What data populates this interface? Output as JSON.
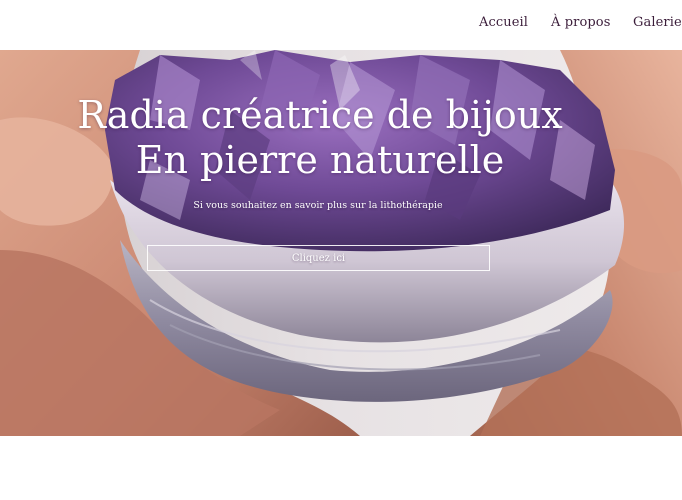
{
  "nav": {
    "items": [
      {
        "label": "Accueil"
      },
      {
        "label": "À propos"
      },
      {
        "label": "Galerie"
      }
    ]
  },
  "hero": {
    "title_line1": "Radia créatrice de bijoux",
    "title_line2": "En pierre naturelle",
    "subtitle": "Si vous souhaitez en savoir plus sur la lithothérapie",
    "cta_label": "Cliquez ici",
    "image_subject": "amethyst-cluster-in-hands"
  },
  "colors": {
    "nav_text": "#3b1d3a",
    "background": "#ffffff",
    "hero_text": "#ffffff",
    "amethyst": "#7b4f9e"
  }
}
